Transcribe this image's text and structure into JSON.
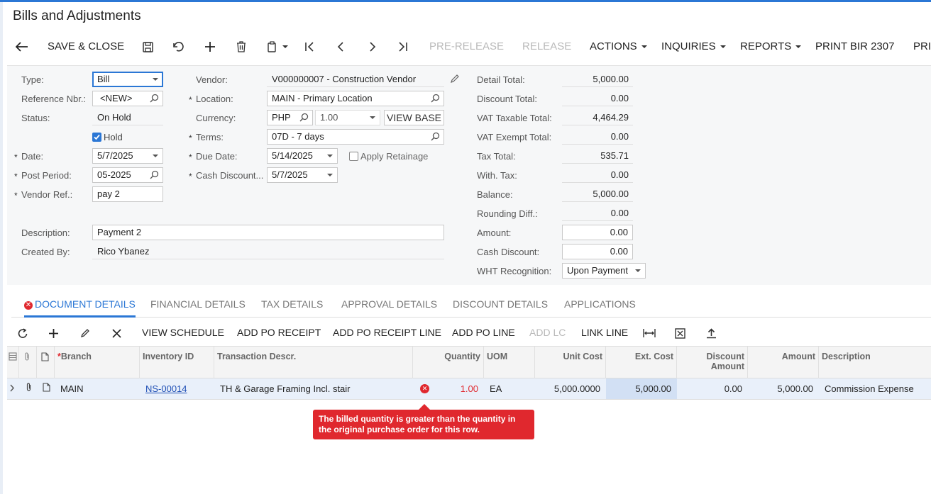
{
  "page_title": "Bills and Adjustments",
  "toolbar": {
    "save_close": "SAVE & CLOSE",
    "pre_release": "PRE-RELEASE",
    "release": "RELEASE",
    "actions": "ACTIONS",
    "inquiries": "INQUIRIES",
    "reports": "REPORTS",
    "print_bir": "PRINT BIR 2307",
    "overflow": "PRI"
  },
  "form": {
    "type_label": "Type:",
    "type_value": "Bill",
    "refnbr_label": "Reference Nbr.:",
    "refnbr_value": "<NEW>",
    "status_label": "Status:",
    "status_value": "On Hold",
    "hold_label": "Hold",
    "date_label": "Date:",
    "date_value": "5/7/2025",
    "postperiod_label": "Post Period:",
    "postperiod_value": "05-2025",
    "vendorref_label": "Vendor Ref.:",
    "vendorref_value": "pay 2",
    "description_label": "Description:",
    "description_value": "Payment 2",
    "createdby_label": "Created By:",
    "createdby_value": "Rico Ybanez",
    "vendor_label": "Vendor:",
    "vendor_value": "V000000007 - Construction Vendor",
    "location_label": "Location:",
    "location_value": "MAIN - Primary Location",
    "currency_label": "Currency:",
    "currency_value": "PHP",
    "rate_value": "1.00",
    "view_base": "VIEW BASE",
    "terms_label": "Terms:",
    "terms_value": "07D - 7 days",
    "duedate_label": "Due Date:",
    "duedate_value": "5/14/2025",
    "apply_retainage": "Apply Retainage",
    "cashdisc_label": "Cash Discount...",
    "cashdisc_value": "5/7/2025"
  },
  "totals": {
    "detail_total_label": "Detail Total:",
    "detail_total": "5,000.00",
    "discount_total_label": "Discount Total:",
    "discount_total": "0.00",
    "vat_taxable_label": "VAT Taxable Total:",
    "vat_taxable": "4,464.29",
    "vat_exempt_label": "VAT Exempt Total:",
    "vat_exempt": "0.00",
    "tax_total_label": "Tax Total:",
    "tax_total": "535.71",
    "with_tax_label": "With. Tax:",
    "with_tax": "0.00",
    "balance_label": "Balance:",
    "balance": "5,000.00",
    "rounding_label": "Rounding Diff.:",
    "rounding": "0.00",
    "amount_label": "Amount:",
    "amount": "0.00",
    "cash_discount_label": "Cash Discount:",
    "cash_discount": "0.00",
    "wht_label": "WHT Recognition:",
    "wht_value": "Upon Payment"
  },
  "tabs": [
    "DOCUMENT DETAILS",
    "FINANCIAL DETAILS",
    "TAX DETAILS",
    "APPROVAL DETAILS",
    "DISCOUNT DETAILS",
    "APPLICATIONS"
  ],
  "grid_toolbar": {
    "view_schedule": "VIEW SCHEDULE",
    "add_po_receipt": "ADD PO RECEIPT",
    "add_po_receipt_line": "ADD PO RECEIPT LINE",
    "add_po_line": "ADD PO LINE",
    "add_lc": "ADD LC",
    "link_line": "LINK LINE"
  },
  "grid": {
    "headers": {
      "branch": "Branch",
      "inventory_id": "Inventory ID",
      "trans_descr": "Transaction Descr.",
      "quantity": "Quantity",
      "uom": "UOM",
      "unit_cost": "Unit Cost",
      "ext_cost": "Ext. Cost",
      "discount_amount": "Discount Amount",
      "amount": "Amount",
      "description": "Description"
    },
    "rows": [
      {
        "branch": "MAIN",
        "inventory_id": "NS-00014",
        "trans_descr": "TH & Garage Framing Incl. stair",
        "quantity": "1.00",
        "uom": "EA",
        "unit_cost": "5,000.0000",
        "ext_cost": "5,000.00",
        "discount_amount": "0.00",
        "amount": "5,000.00",
        "description": "Commission Expense"
      }
    ]
  },
  "error_tooltip": "The billed quantity is greater than the quantity in the original purchase order for this row."
}
